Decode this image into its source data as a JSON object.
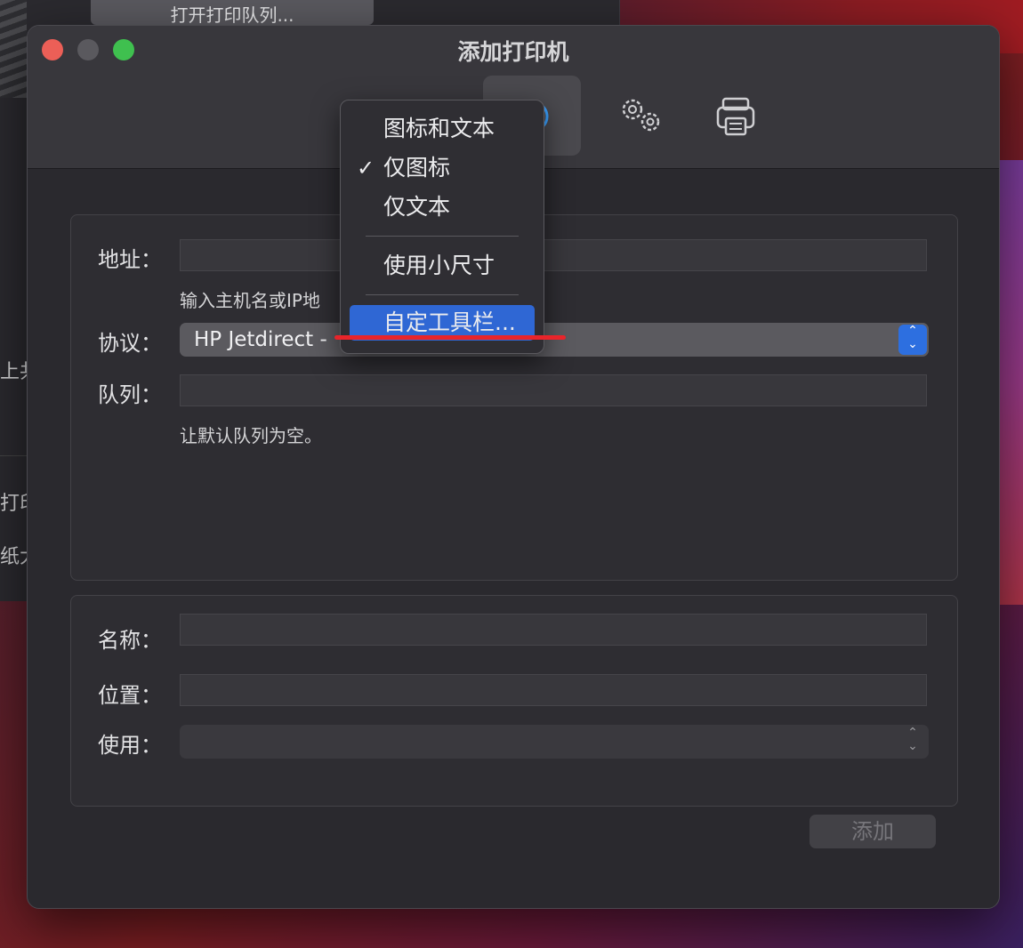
{
  "background_window": {
    "button_label": "打开打印队列...",
    "side_texts": [
      "上共",
      "打印",
      "纸大"
    ]
  },
  "window": {
    "title": "添加打印机",
    "toolbar_items": [
      {
        "name": "ip",
        "icon": "globe-icon"
      },
      {
        "name": "windows",
        "icon": "gears-icon"
      },
      {
        "name": "printer",
        "icon": "printer-icon"
      }
    ]
  },
  "form": {
    "address_label": "地址：",
    "address_value": "",
    "address_hint": "输入主机名或IP地",
    "protocol_label": "协议：",
    "protocol_value": "HP Jetdirect -",
    "queue_label": "队列：",
    "queue_value": "",
    "queue_hint": "让默认队列为空。",
    "name_label": "名称：",
    "name_value": "",
    "location_label": "位置：",
    "location_value": "",
    "use_label": "使用：",
    "use_value": ""
  },
  "add_button": "添加",
  "context_menu": {
    "items": [
      {
        "label": "图标和文本",
        "checked": false
      },
      {
        "label": "仅图标",
        "checked": true
      },
      {
        "label": "仅文本",
        "checked": false
      },
      {
        "label": "使用小尺寸",
        "checked": false
      },
      {
        "label": "自定工具栏...",
        "checked": false,
        "highlighted": true
      }
    ],
    "check_glyph": "✓"
  },
  "colors": {
    "accent": "#2f67d4",
    "annotation": "#e8242a"
  }
}
